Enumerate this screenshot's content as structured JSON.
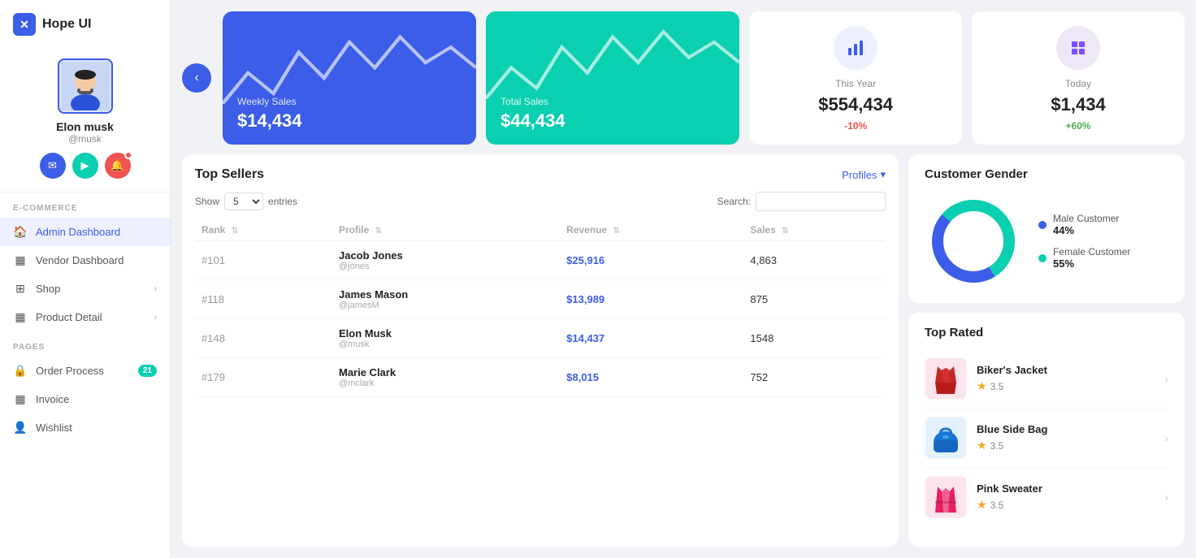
{
  "sidebar": {
    "logo": "Hope UI",
    "profile": {
      "name": "Elon musk",
      "handle": "@musk"
    },
    "sections": [
      {
        "label": "E-COMMERCE",
        "items": [
          {
            "id": "admin-dashboard",
            "label": "Admin Dashboard",
            "icon": "🏠",
            "active": true,
            "arrow": false,
            "badge": null
          },
          {
            "id": "vendor-dashboard",
            "label": "Vendor Dashboard",
            "icon": "▦",
            "active": false,
            "arrow": false,
            "badge": null
          },
          {
            "id": "shop",
            "label": "Shop",
            "icon": "⊞",
            "active": false,
            "arrow": true,
            "badge": null
          },
          {
            "id": "product-detail",
            "label": "Product Detail",
            "icon": "▦",
            "active": false,
            "arrow": true,
            "badge": null
          }
        ]
      },
      {
        "label": "PAGES",
        "items": [
          {
            "id": "order-process",
            "label": "Order Process",
            "icon": "🔒",
            "active": false,
            "arrow": false,
            "badge": "21"
          },
          {
            "id": "invoice",
            "label": "Invoice",
            "icon": "▦",
            "active": false,
            "arrow": false,
            "badge": null
          },
          {
            "id": "wishlist",
            "label": "Wishlist",
            "icon": "👤",
            "active": false,
            "arrow": false,
            "badge": null
          }
        ]
      }
    ]
  },
  "stats": {
    "weekly": {
      "label": "Weekly Sales",
      "value": "$14,434"
    },
    "total": {
      "label": "Total Sales",
      "value": "$44,434"
    },
    "this_year": {
      "label": "This Year",
      "value": "$554,434",
      "change": "-10%",
      "change_type": "neg"
    },
    "today": {
      "label": "Today",
      "value": "$1,434",
      "change": "+60%",
      "change_type": "pos"
    }
  },
  "sellers": {
    "title": "Top Sellers",
    "profiles_btn": "Profiles",
    "show_label": "Show",
    "entries_label": "entries",
    "search_label": "Search:",
    "entries_value": "5",
    "columns": [
      "Rank",
      "Profile",
      "Revenue",
      "Sales"
    ],
    "rows": [
      {
        "rank": "#101",
        "name": "Jacob Jones",
        "handle": "@jones",
        "revenue": "$25,916",
        "sales": "4,863"
      },
      {
        "rank": "#118",
        "name": "James Mason",
        "handle": "@jamesM",
        "revenue": "$13,989",
        "sales": "875"
      },
      {
        "rank": "#148",
        "name": "Elon Musk",
        "handle": "@musk",
        "revenue": "$14,437",
        "sales": "1548"
      },
      {
        "rank": "#179",
        "name": "Marie Clark",
        "handle": "@mclark",
        "revenue": "$8,015",
        "sales": "752"
      }
    ]
  },
  "gender": {
    "title": "Customer Gender",
    "male": {
      "label": "Male Customer",
      "pct": "44%",
      "color": "#3b5de7"
    },
    "female": {
      "label": "Female Customer",
      "pct": "55%",
      "color": "#0acfb0"
    }
  },
  "top_rated": {
    "title": "Top Rated",
    "items": [
      {
        "name": "Biker's Jacket",
        "rating": "3.5",
        "color": "#c62828"
      },
      {
        "name": "Blue Side Bag",
        "rating": "3.5",
        "color": "#1976d2"
      },
      {
        "name": "Pink Sweater",
        "rating": "3.5",
        "color": "#e91e63"
      }
    ]
  }
}
